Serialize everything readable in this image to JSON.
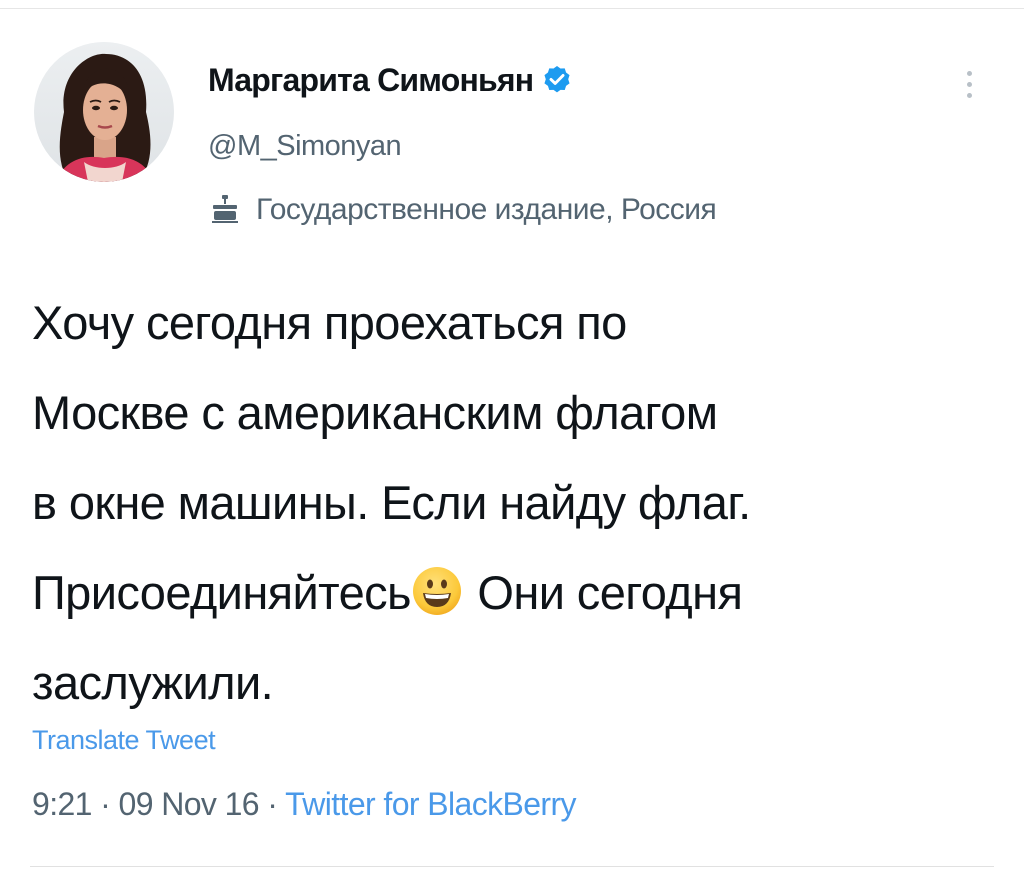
{
  "tweet": {
    "author": {
      "display_name": "Маргарита Симоньян",
      "handle": "@M_Simonyan",
      "verified": true,
      "avatar_icon": "profile-photo",
      "label_icon": "state-media-icon",
      "label_text": "Государственное издание, Россия"
    },
    "more_icon": "more-vertical-icon",
    "text_lines": [
      "Хочу сегодня проехаться по",
      "Москве с американским флагом",
      "в окне машины. Если найду флаг."
    ],
    "line4_before_emoji": "Присоединяйтесь",
    "emoji": "grinning-face",
    "line4_after_emoji": " Они сегодня",
    "line5": "заслужили.",
    "translate_label": "Translate Tweet",
    "time": "9:21",
    "date": "09 Nov 16",
    "separator": " · ",
    "source": "Twitter for BlackBerry"
  },
  "colors": {
    "text_primary": "#0f1419",
    "text_secondary": "#536471",
    "link_blue": "#4a99e9",
    "verified_blue": "#1d9bf0"
  }
}
